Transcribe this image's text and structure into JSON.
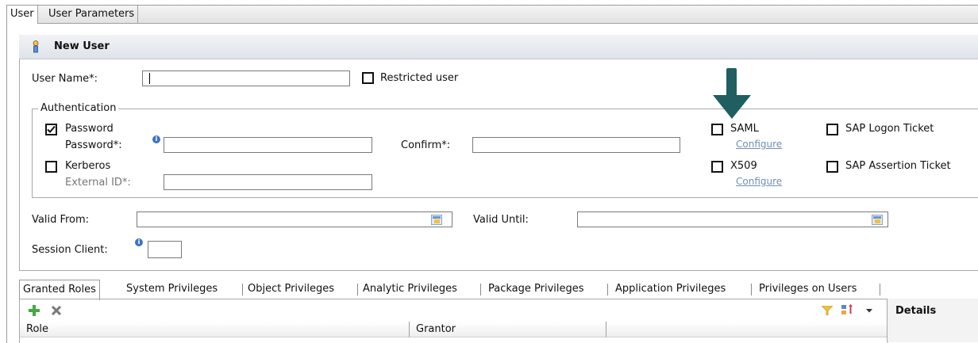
{
  "top_tabs": [
    {
      "label": "User"
    },
    {
      "label": "User Parameters"
    }
  ],
  "panel": {
    "title": "New User"
  },
  "user_name": {
    "label": "User Name*:",
    "value": ""
  },
  "restricted_user": {
    "label": "Restricted user",
    "checked": false
  },
  "authentication": {
    "legend": "Authentication",
    "password": {
      "label": "Password",
      "checked": true,
      "password_label": "Password*:",
      "confirm_label": "Confirm*:"
    },
    "kerberos": {
      "label": "Kerberos",
      "checked": false,
      "external_id_label": "External ID*:"
    },
    "saml": {
      "label": "SAML",
      "checked": false,
      "configure": "Configure"
    },
    "x509": {
      "label": "X509",
      "checked": false,
      "configure": "Configure"
    },
    "sap_logon_ticket": {
      "label": "SAP Logon Ticket",
      "checked": false
    },
    "sap_assertion_ticket": {
      "label": "SAP Assertion Ticket",
      "checked": false
    }
  },
  "valid_from": {
    "label": "Valid From:"
  },
  "valid_until": {
    "label": "Valid Until:"
  },
  "session_client": {
    "label": "Session Client:"
  },
  "bottom_tabs": [
    {
      "label": "Granted Roles"
    },
    {
      "label": "System Privileges"
    },
    {
      "label": "Object Privileges"
    },
    {
      "label": "Analytic Privileges"
    },
    {
      "label": "Package Privileges"
    },
    {
      "label": "Application Privileges"
    },
    {
      "label": "Privileges on Users"
    }
  ],
  "table": {
    "columns": [
      "Role",
      "Grantor"
    ]
  },
  "details": {
    "title": "Details"
  },
  "colors": {
    "arrow": "#1f5e61",
    "link": "#6f8fb8",
    "accent": "#3b73c6"
  },
  "icons": [
    "user-icon",
    "info-icon",
    "calendar-icon",
    "add-icon",
    "remove-icon",
    "filter-icon",
    "sort-icon",
    "dropdown-icon",
    "arrow-pointer"
  ]
}
